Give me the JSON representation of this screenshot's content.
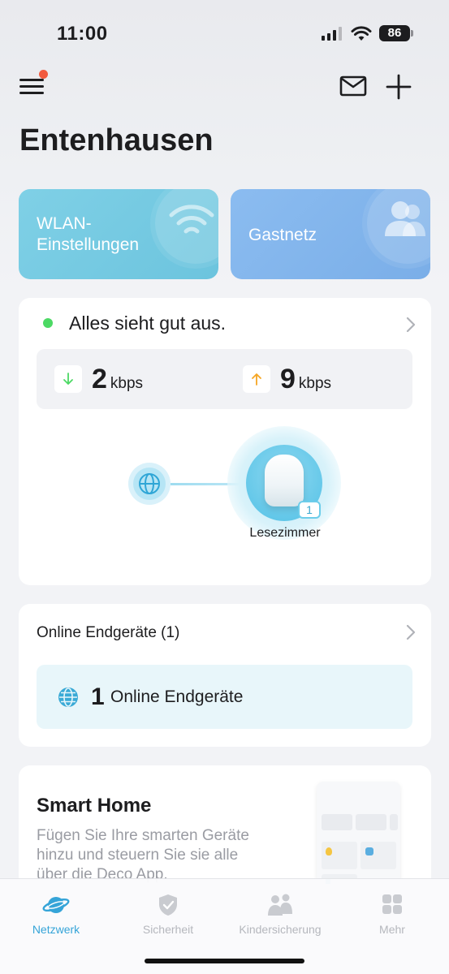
{
  "status_bar": {
    "time": "11:00",
    "battery": "86"
  },
  "header": {
    "title": "Entenhausen",
    "menu_has_notification": true
  },
  "tiles": {
    "wlan": {
      "label": "WLAN-Einstellungen",
      "color": "#74c9e2"
    },
    "guest": {
      "label": "Gastnetz",
      "color": "#82b5ec"
    }
  },
  "network_card": {
    "status_text": "Alles sieht gut aus.",
    "status_color": "#4cd964",
    "download": {
      "value": "2",
      "unit": "kbps"
    },
    "upload": {
      "value": "9",
      "unit": "kbps"
    },
    "deco_name": "Lesezimmer",
    "deco_client_count": "1"
  },
  "devices_card": {
    "title": "Online Endgeräte (1)",
    "count": "1",
    "label": "Online Endgeräte"
  },
  "smart_home_card": {
    "title": "Smart Home",
    "description": "Fügen Sie Ihre smarten Geräte hinzu und steuern Sie sie alle über die Deco App."
  },
  "tabbar": {
    "items": [
      {
        "label": "Netzwerk",
        "icon": "planet-icon",
        "active": true
      },
      {
        "label": "Sicherheit",
        "icon": "shield-check-icon",
        "active": false
      },
      {
        "label": "Kindersicherung",
        "icon": "family-icon",
        "active": false
      },
      {
        "label": "Mehr",
        "icon": "grid-icon",
        "active": false
      }
    ],
    "active_color": "#35a4d8"
  }
}
